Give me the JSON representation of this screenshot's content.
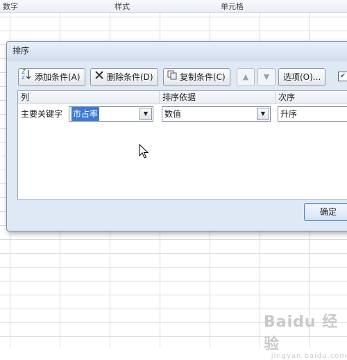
{
  "ribbon": {
    "groups": [
      "数字",
      "样式",
      "单元格"
    ]
  },
  "dialog": {
    "title": "排序",
    "toolbar": {
      "add_label": "添加条件(A)",
      "delete_label": "删除条件(D)",
      "copy_label": "复制条件(C)",
      "options_label": "选项(O)...",
      "header_checked": true
    },
    "columns": {
      "col": "列",
      "sort_on": "排序依据",
      "order": "次序"
    },
    "row": {
      "label": "主要关键字",
      "key_value": "市占率",
      "sort_on_value": "数值",
      "order_value": "升序"
    },
    "ok_label": "确定"
  },
  "watermark": {
    "brand": "Baidu 经验",
    "sub": "jingyan.baidu.com"
  },
  "colors": {
    "selection": "#3b7bd6",
    "dialog_bg": "#dfe9f5"
  }
}
